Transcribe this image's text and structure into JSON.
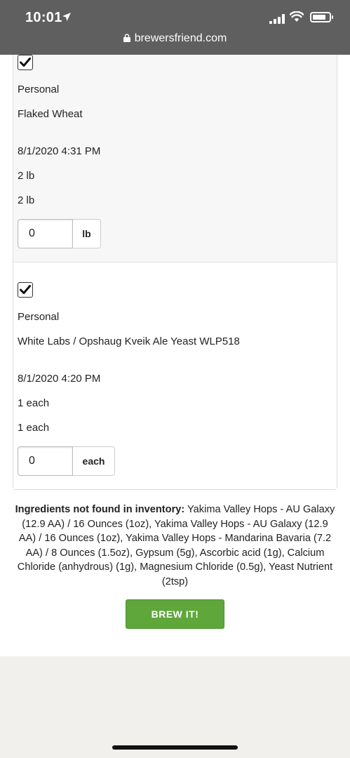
{
  "status_bar": {
    "time": "10:01",
    "url": "brewersfriend.com"
  },
  "items": [
    {
      "checked": true,
      "type": "Personal",
      "name": "Flaked Wheat",
      "date": "8/1/2020 4:31 PM",
      "amount_1": "2 lb",
      "amount_2": "2 lb",
      "input_value": "0",
      "unit": "lb"
    },
    {
      "checked": true,
      "type": "Personal",
      "name": "White Labs / Opshaug Kveik Ale Yeast WLP518",
      "date": "8/1/2020 4:20 PM",
      "amount_1": "1 each",
      "amount_2": "1 each",
      "input_value": "0",
      "unit": "each"
    }
  ],
  "missing": {
    "label": "Ingredients not found in inventory:",
    "text": " Yakima Valley Hops - AU Galaxy (12.9 AA) / 16 Ounces (1oz), Yakima Valley Hops - AU Galaxy (12.9 AA) / 16 Ounces (1oz), Yakima Valley Hops - Mandarina Bavaria (7.2 AA) / 8 Ounces (1.5oz), Gypsum (5g), Ascorbic acid (1g), Calcium Chloride (anhydrous) (1g), Magnesium Chloride (0.5g), Yeast Nutrient (2tsp)"
  },
  "brew_button": {
    "label": "BREW IT!",
    "color": "#5fa73a"
  }
}
